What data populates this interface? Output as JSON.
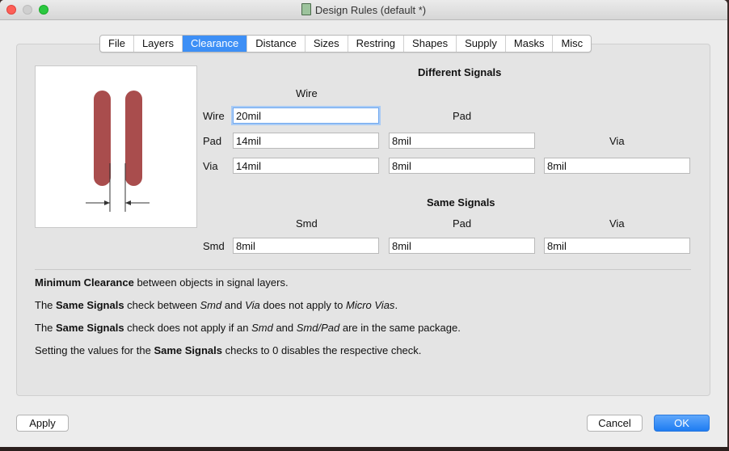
{
  "window": {
    "title": "Design Rules (default *)"
  },
  "tabs": [
    {
      "label": "File",
      "active": false
    },
    {
      "label": "Layers",
      "active": false
    },
    {
      "label": "Clearance",
      "active": true
    },
    {
      "label": "Distance",
      "active": false
    },
    {
      "label": "Sizes",
      "active": false
    },
    {
      "label": "Restring",
      "active": false
    },
    {
      "label": "Shapes",
      "active": false
    },
    {
      "label": "Supply",
      "active": false
    },
    {
      "label": "Masks",
      "active": false
    },
    {
      "label": "Misc",
      "active": false
    }
  ],
  "different_signals": {
    "heading": "Different Signals",
    "col_wire": "Wire",
    "col_pad": "Pad",
    "col_via": "Via",
    "row_wire": "Wire",
    "row_pad": "Pad",
    "row_via": "Via",
    "wire_wire": "20mil",
    "pad_wire": "14mil",
    "pad_pad": "8mil",
    "via_wire": "14mil",
    "via_pad": "8mil",
    "via_via": "8mil"
  },
  "same_signals": {
    "heading": "Same Signals",
    "col_smd": "Smd",
    "col_pad": "Pad",
    "col_via": "Via",
    "row_smd": "Smd",
    "smd_smd": "8mil",
    "smd_pad": "8mil",
    "smd_via": "8mil"
  },
  "description": {
    "line1": {
      "b1": "Minimum Clearance",
      "t1": " between objects in signal layers."
    },
    "line2": {
      "t0": "The ",
      "b1": "Same Signals",
      "t1": " check between ",
      "i1": "Smd",
      "t2": " and ",
      "i2": "Via",
      "t3": " does not apply to ",
      "i3": "Micro Vias",
      "t4": "."
    },
    "line3": {
      "t0": "The ",
      "b1": "Same Signals",
      "t1": " check does not apply if an ",
      "i1": "Smd",
      "t2": " and ",
      "i2": "Smd/Pad",
      "t3": " are in the same package."
    },
    "line4": {
      "t0": "Setting the values for the ",
      "b1": "Same Signals",
      "t1": " checks to 0 disables the respective check."
    }
  },
  "buttons": {
    "apply": "Apply",
    "cancel": "Cancel",
    "ok": "OK"
  },
  "colors": {
    "accent": "#3d8ff6",
    "wire_fill": "#a94d4d",
    "ok_button": "#1e7cf2"
  }
}
